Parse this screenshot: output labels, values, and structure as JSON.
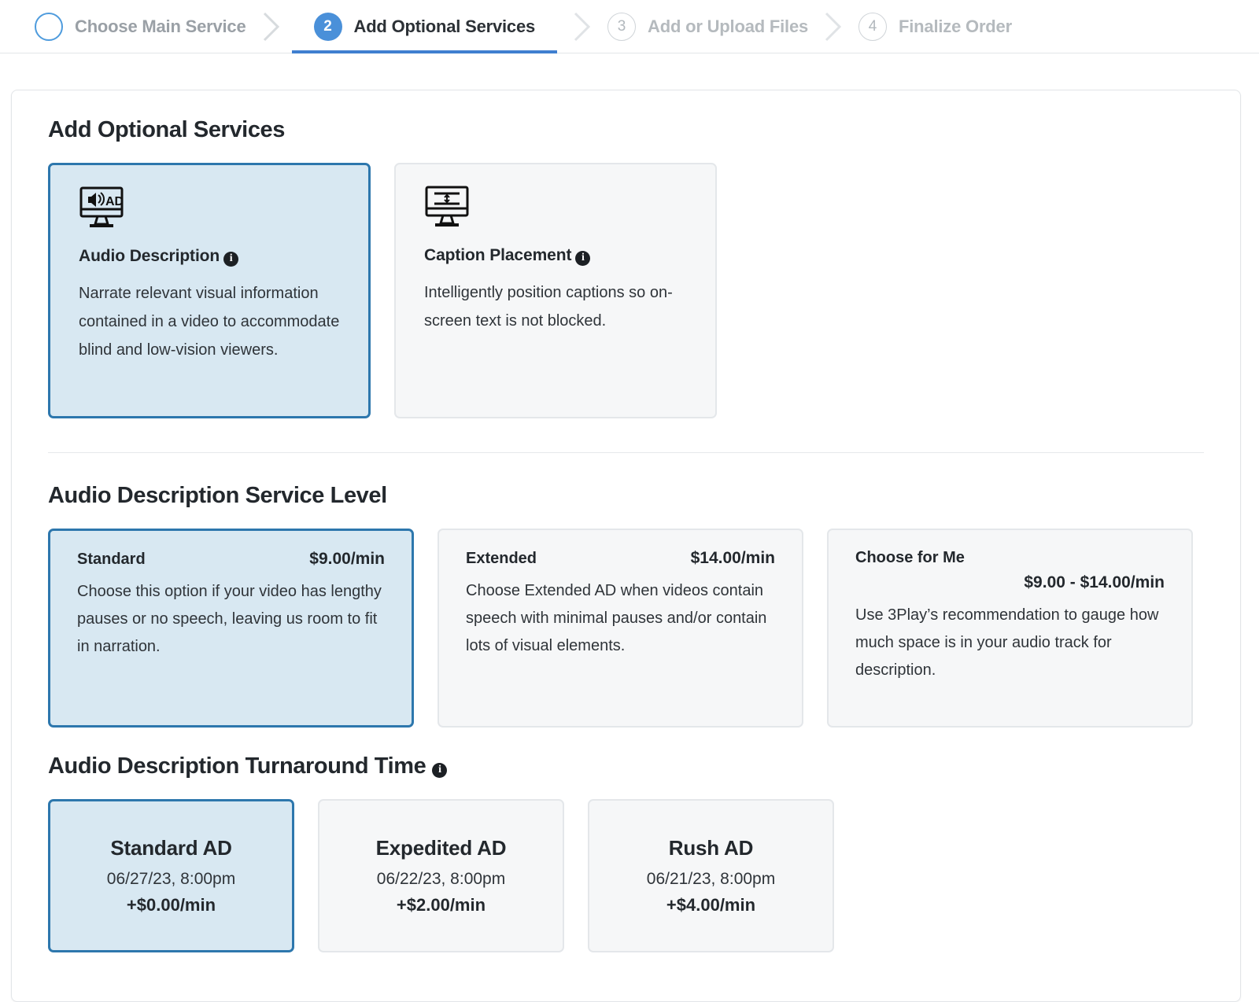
{
  "stepper": {
    "steps": [
      {
        "badge": "",
        "label": "Choose Main Service",
        "state": "done",
        "icon": "circle-outline-icon"
      },
      {
        "badge": "2",
        "label": "Add Optional Services",
        "state": "active",
        "icon": "step-number-badge"
      },
      {
        "badge": "3",
        "label": "Add or Upload Files",
        "state": "todo",
        "icon": "step-number-badge"
      },
      {
        "badge": "4",
        "label": "Finalize Order",
        "state": "todo",
        "icon": "step-number-badge"
      }
    ]
  },
  "optional_services": {
    "title": "Add Optional Services",
    "cards": [
      {
        "name": "Audio Description",
        "description": "Narrate relevant visual information contained in a video to accommodate blind and low-vision viewers.",
        "icon": "monitor-audio-description-icon",
        "selected": true
      },
      {
        "name": "Caption Placement",
        "description": "Intelligently position captions so on-screen text is not blocked.",
        "icon": "monitor-caption-placement-icon",
        "selected": false
      }
    ]
  },
  "service_level": {
    "title": "Audio Description Service Level",
    "options": [
      {
        "name": "Standard",
        "price": "$9.00/min",
        "description": "Choose this option if your video has lengthy pauses or no speech, leaving us room to fit in narration.",
        "selected": true
      },
      {
        "name": "Extended",
        "price": "$14.00/min",
        "description": "Choose Extended AD when videos contain speech with minimal pauses and/or contain lots of visual elements.",
        "selected": false
      },
      {
        "name": "Choose for Me",
        "price": "$9.00 - $14.00/min",
        "description": "Use 3Play’s recommendation to gauge how much space is in your audio track for description.",
        "selected": false
      }
    ]
  },
  "turnaround": {
    "title": "Audio Description Turnaround Time",
    "options": [
      {
        "name": "Standard AD",
        "date": "06/27/23, 8:00pm",
        "price": "+$0.00/min",
        "selected": true
      },
      {
        "name": "Expedited AD",
        "date": "06/22/23, 8:00pm",
        "price": "+$2.00/min",
        "selected": false
      },
      {
        "name": "Rush AD",
        "date": "06/21/23, 8:00pm",
        "price": "+$4.00/min",
        "selected": false
      }
    ]
  },
  "colors": {
    "accent_blue": "#4a90d9",
    "selected_border": "#2d77ad",
    "selected_fill": "#d8e8f2",
    "card_fill": "#f6f7f8",
    "text": "#23282d",
    "muted_text": "#9aa0a6"
  },
  "info_glyph": "i"
}
